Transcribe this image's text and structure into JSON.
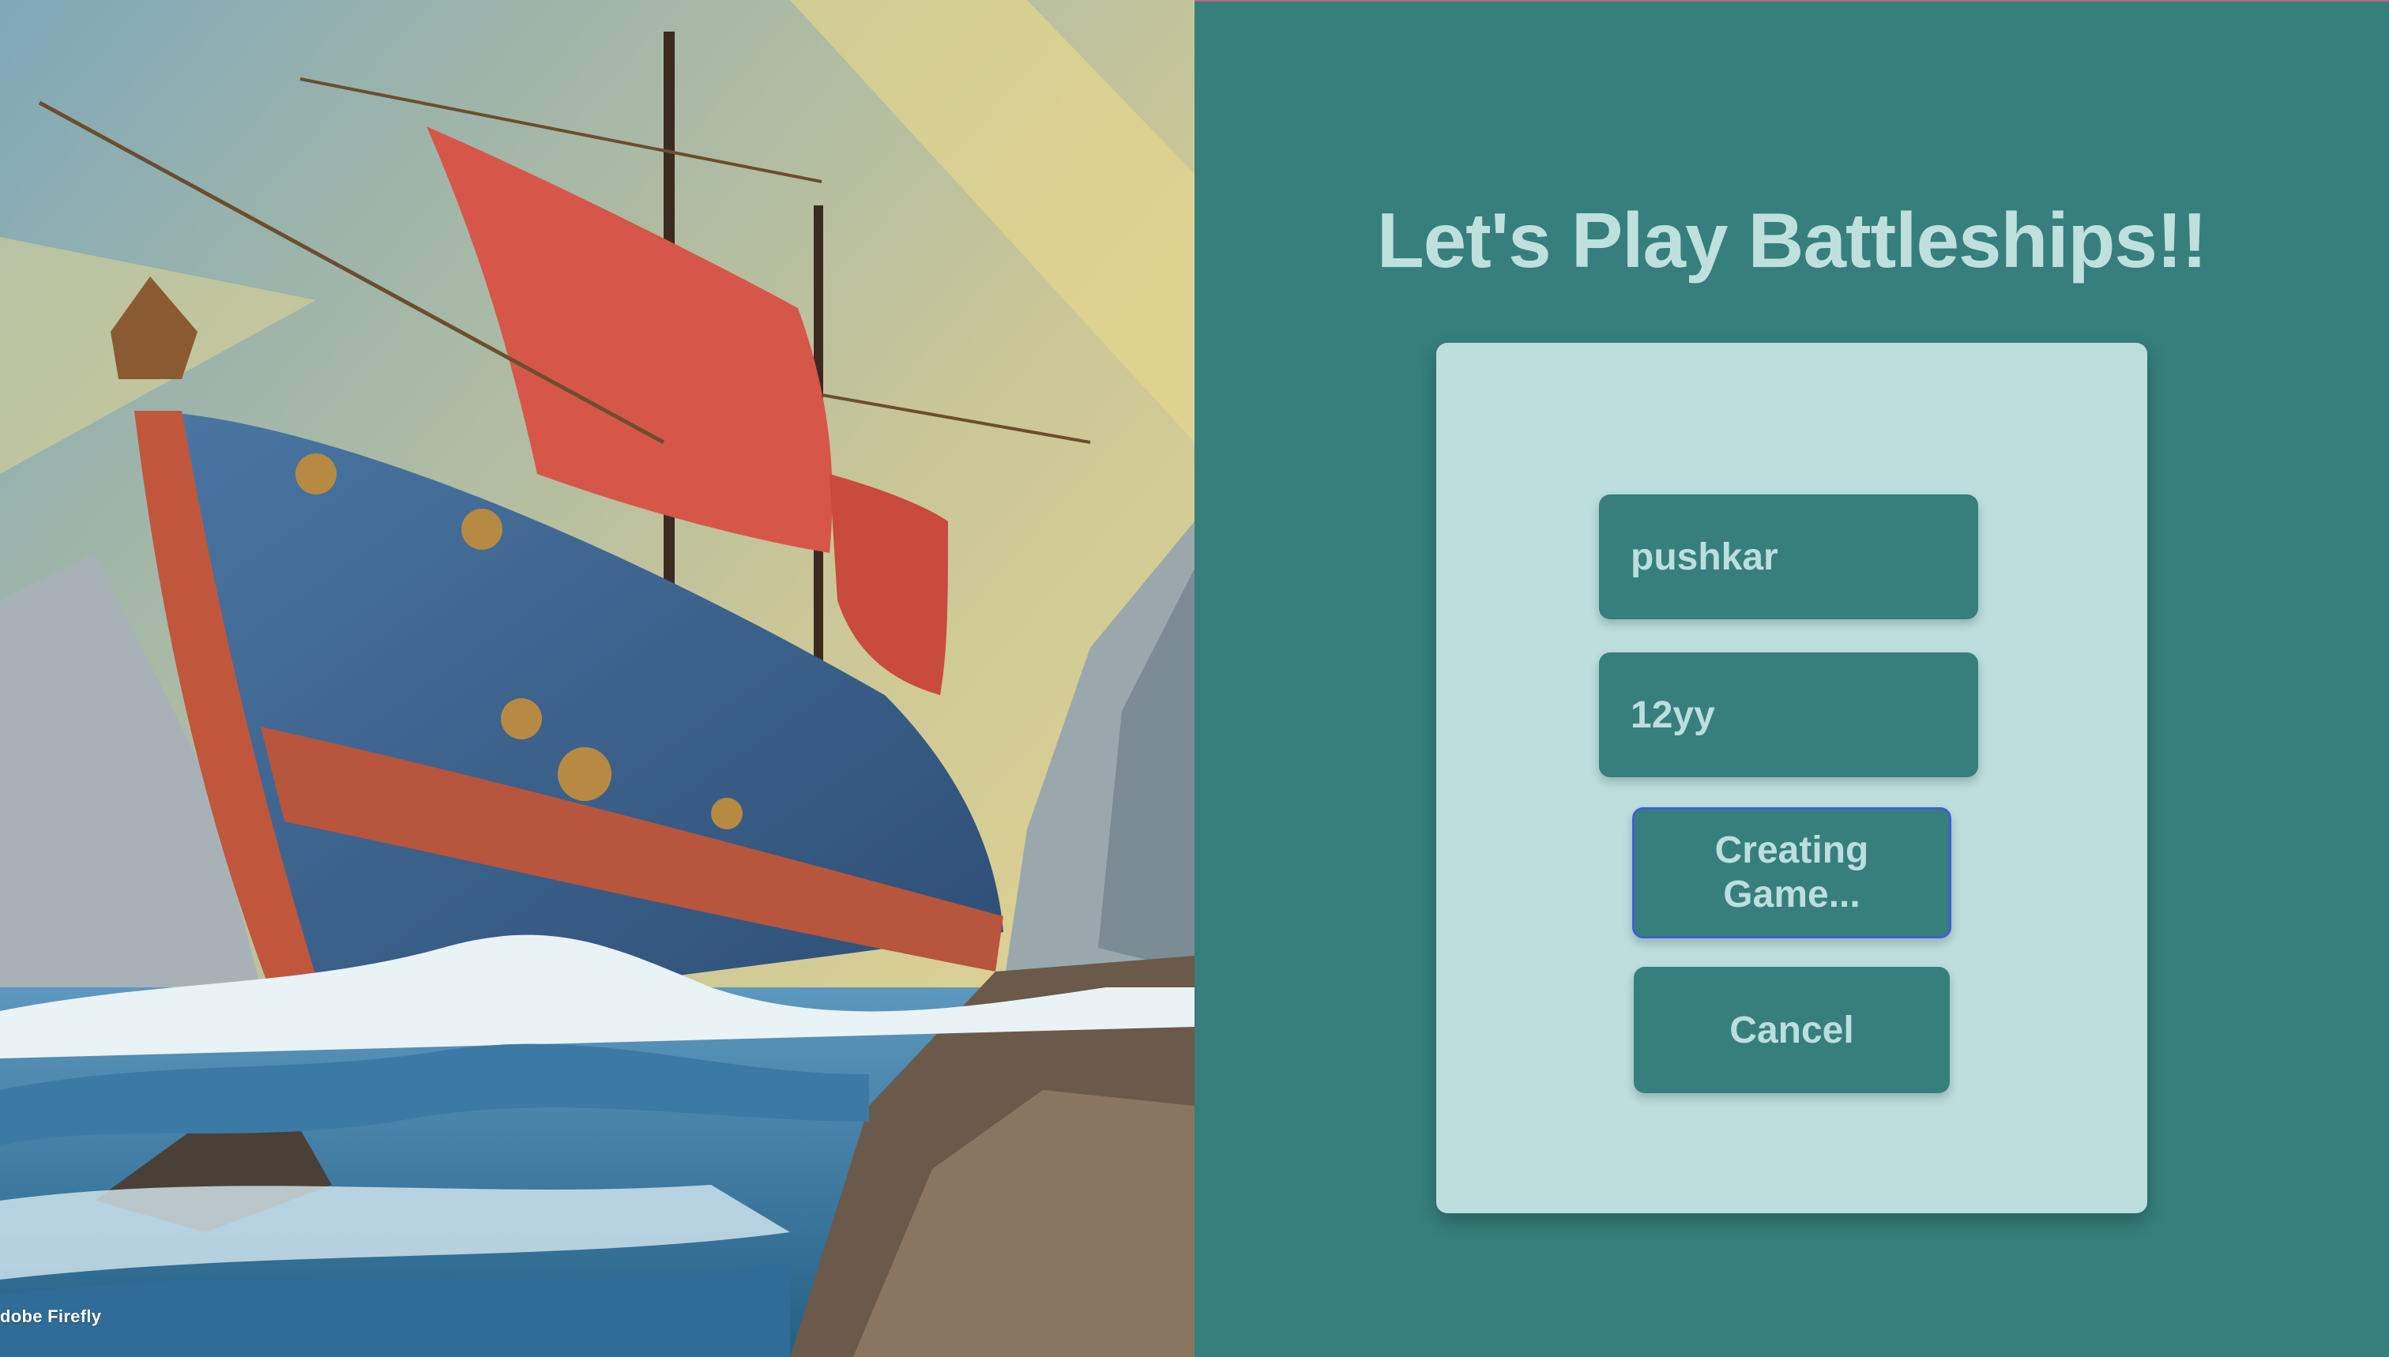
{
  "art": {
    "watermark": "dobe Firefly"
  },
  "main": {
    "title": "Let's Play Battleships!!"
  },
  "form": {
    "player_name_value": "pushkar",
    "game_code_value": "12yy",
    "create_button_label": "Creating Game...",
    "cancel_button_label": "Cancel"
  },
  "colors": {
    "background": "#367f7c",
    "card": "#bcdedd",
    "accent_text": "#bcdedd",
    "focus_ring": "#3d5fd8"
  }
}
